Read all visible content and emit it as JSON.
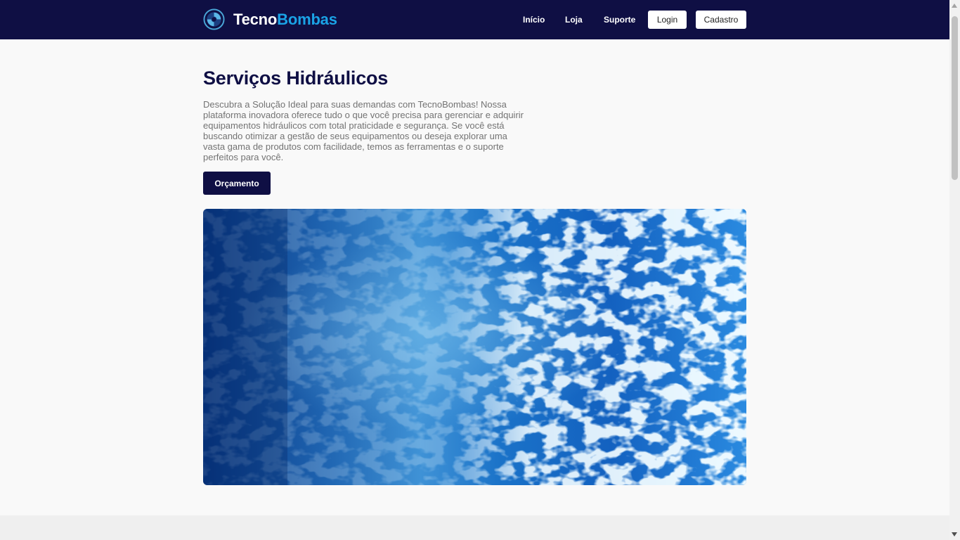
{
  "brand": {
    "part1": "Tecno",
    "part2": "Bombas",
    "accent": "#1aa3e6",
    "navbar_bg": "#0f0f44"
  },
  "nav": {
    "links": [
      "Início",
      "Loja",
      "Suporte"
    ],
    "login_label": "Login",
    "signup_label": "Cadastro"
  },
  "hero": {
    "title": "Serviços Hidráulicos",
    "description": "Descubra a Solução Ideal para suas demandas com TecnoBombas! Nossa plataforma inovadora oferece tudo o que você precisa para gerenciar e adquirir equipamentos hidráulicos com total praticidade e segurança. Se você está buscando otimizar a gestão de seus equipamentos ou deseja explorar uma vasta gama de produtos com facilidade, temos as ferramentas e o suporte perfeitos para você.",
    "cta_label": "Orçamento"
  },
  "icons": {
    "logo": "pump-impeller-icon",
    "image": "water-surface-image"
  }
}
